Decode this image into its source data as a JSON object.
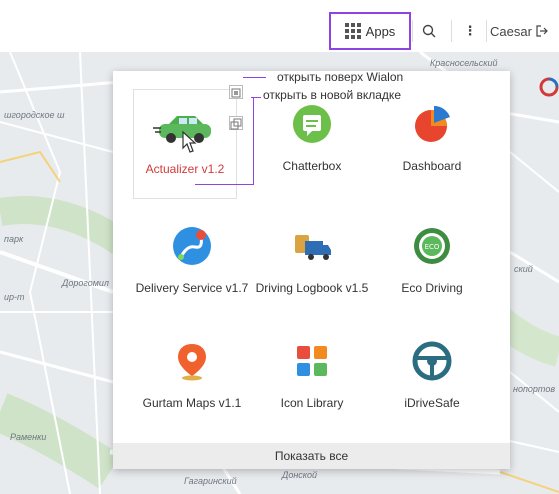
{
  "toolbar": {
    "apps_label": "Apps",
    "user_label": "Caesar"
  },
  "map": {
    "labels": {
      "krasnoselsky": "Красносельский",
      "novogorodskoe": "шгородское ш",
      "park": "парк",
      "dorogomil": "Дорогомил",
      "dzhip": "ир-т",
      "ramenki": "Раменки",
      "gagarinsky": "Гагаринский",
      "donskoy": "Донской",
      "noportov": "нопортов",
      "skiy": "ский"
    }
  },
  "annotations": {
    "open_over": "открыть поверх Wialon",
    "open_new_tab": "открыть в новой вкладке"
  },
  "apps": [
    {
      "label": "Actualizer v1.2",
      "icon": "car-icon"
    },
    {
      "label": "Chatterbox",
      "icon": "chat-icon"
    },
    {
      "label": "Dashboard",
      "icon": "pie-chart-icon"
    },
    {
      "label": "Delivery Service v1.7",
      "icon": "route-icon"
    },
    {
      "label": "Driving Logbook v1.5",
      "icon": "truck-icon"
    },
    {
      "label": "Eco Driving",
      "icon": "eco-wheel-icon"
    },
    {
      "label": "Gurtam Maps v1.1",
      "icon": "map-pin-icon"
    },
    {
      "label": "Icon Library",
      "icon": "bus-icon"
    },
    {
      "label": "iDriveSafe",
      "icon": "steering-wheel-icon"
    }
  ],
  "footer": {
    "show_all_label": "Показать все"
  },
  "colors": {
    "accent": "#8e44e0",
    "selected_label": "#d23a3a"
  }
}
